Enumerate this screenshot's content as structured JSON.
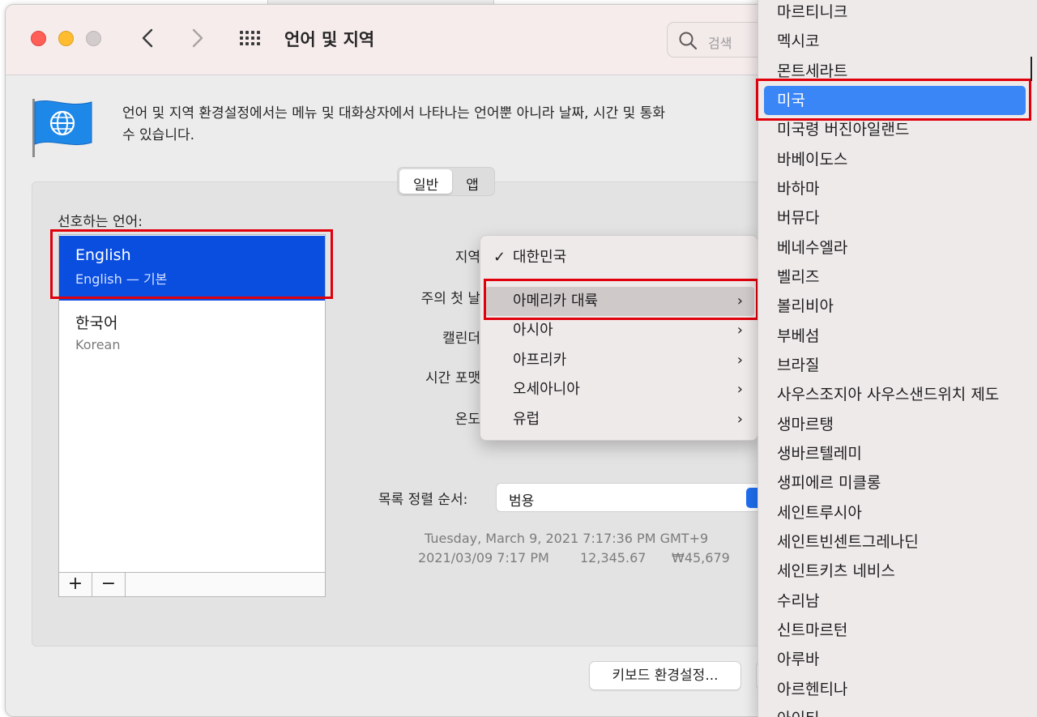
{
  "window": {
    "title": "언어 및 지역",
    "search_placeholder": "검색"
  },
  "description": "언어 및 지역 환경설정에서는 메뉴 및 대화상자에서 나타나는 언어뿐 아니라 날짜, 시간 및 통화 수 있습니다.",
  "description_line1": "언어 및 지역 환경설정에서는 메뉴 및 대화상자에서 나타나는 언어뿐 아니라 날짜, 시간 및 통화",
  "description_line2": "수 있습니다.",
  "tabs": [
    {
      "label": "일반",
      "selected": true
    },
    {
      "label": "앱",
      "selected": false
    }
  ],
  "preferred_languages": {
    "label": "선호하는 언어:",
    "items": [
      {
        "name": "English",
        "sub": "English — 기본",
        "selected": true
      },
      {
        "name": "한국어",
        "sub": "Korean",
        "selected": false
      }
    ],
    "add_label": "+",
    "remove_label": "−"
  },
  "settings_labels": {
    "region": "지역",
    "first_day": "주의 첫 날",
    "calendar": "캘린더",
    "time_format": "시간 포맷",
    "temperature": "온도"
  },
  "sort_order": {
    "label": "목록 정렬 순서:",
    "value": "범용"
  },
  "sample": {
    "line1": "Tuesday, March 9, 2021 7:17:36 PM GMT+9",
    "date_short": "2021/03/09 7:17 PM",
    "number": "12,345.67",
    "currency": "₩45,679"
  },
  "keyboard_button": "키보드 환경설정...",
  "region_menu": [
    {
      "label": "대한민국",
      "checked": true,
      "submenu": false
    },
    {
      "label": "아메리카 대륙",
      "checked": false,
      "submenu": true,
      "highlighted": true
    },
    {
      "label": "아시아",
      "checked": false,
      "submenu": true
    },
    {
      "label": "아프리카",
      "checked": false,
      "submenu": true
    },
    {
      "label": "오세아니아",
      "checked": false,
      "submenu": true
    },
    {
      "label": "유럽",
      "checked": false,
      "submenu": true
    }
  ],
  "americas_menu": [
    "마르티니크",
    "멕시코",
    "몬트세라트",
    "미국",
    "미국령 버진아일랜드",
    "바베이도스",
    "바하마",
    "버뮤다",
    "베네수엘라",
    "벨리즈",
    "볼리비아",
    "부베섬",
    "브라질",
    "사우스조지아 사우스샌드위치 제도",
    "생마르탱",
    "생바르텔레미",
    "생피에르 미클롱",
    "세인트루시아",
    "세인트빈센트그레나딘",
    "세인트키츠 네비스",
    "수리남",
    "신트마르턴",
    "아루바",
    "아르헨티나",
    "아이티"
  ],
  "americas_highlighted": "미국",
  "colors": {
    "selection_blue": "#0a4ee0",
    "menu_highlight": "#3b86f7",
    "annotation_red": "#e0000b"
  },
  "icons": [
    "back-chevron-icon",
    "forward-chevron-icon",
    "grid-icon",
    "search-icon",
    "globe-flag-icon",
    "checkmark-icon",
    "submenu-arrow-icon"
  ]
}
